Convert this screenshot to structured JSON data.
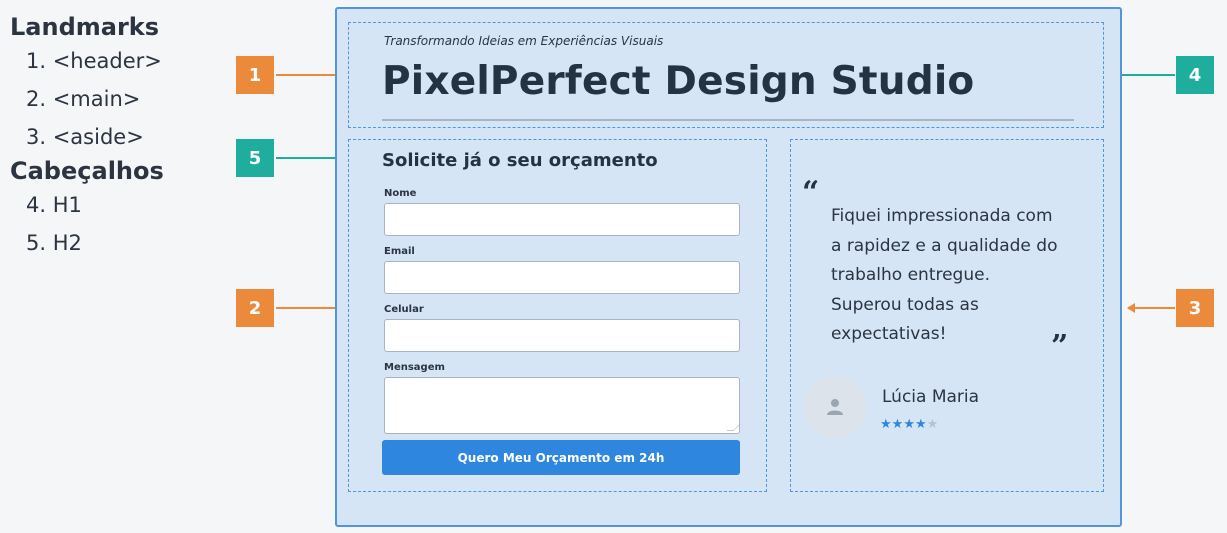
{
  "legend": {
    "landmarks_heading": "Landmarks",
    "landmarks": [
      "1. <header>",
      "2. <main>",
      "3. <aside>"
    ],
    "headings_heading": "Cabeçalhos",
    "headings": [
      "4. H1",
      "5. H2"
    ]
  },
  "badges": {
    "b1": "1",
    "b2": "2",
    "b3": "3",
    "b4": "4",
    "b5": "5"
  },
  "colors": {
    "landmark_accent": "#ec8a3c",
    "heading_accent": "#1fae9e",
    "outline": "#4f95e0",
    "page_bg": "#d5e5f5",
    "button": "#2e86de"
  },
  "header": {
    "tagline": "Transformando Ideias em Experiências Visuais",
    "title": "PixelPerfect Design Studio"
  },
  "form": {
    "title": "Solicite já o seu orçamento",
    "fields": [
      {
        "label": "Nome",
        "value": ""
      },
      {
        "label": "Email",
        "value": ""
      },
      {
        "label": "Celular",
        "value": ""
      },
      {
        "label": "Mensagem",
        "value": ""
      }
    ],
    "submit_label": "Quero Meu Orçamento em 24h"
  },
  "testimonial": {
    "quote": "Fiquei impressionada com a rapidez e a qualidade do trabalho entregue. Superou todas as expectativas!",
    "open_quote": "“",
    "close_quote": "”",
    "author": "Lúcia Maria",
    "avatar_icon": "user-icon",
    "rating": 4,
    "rating_max": 5
  }
}
